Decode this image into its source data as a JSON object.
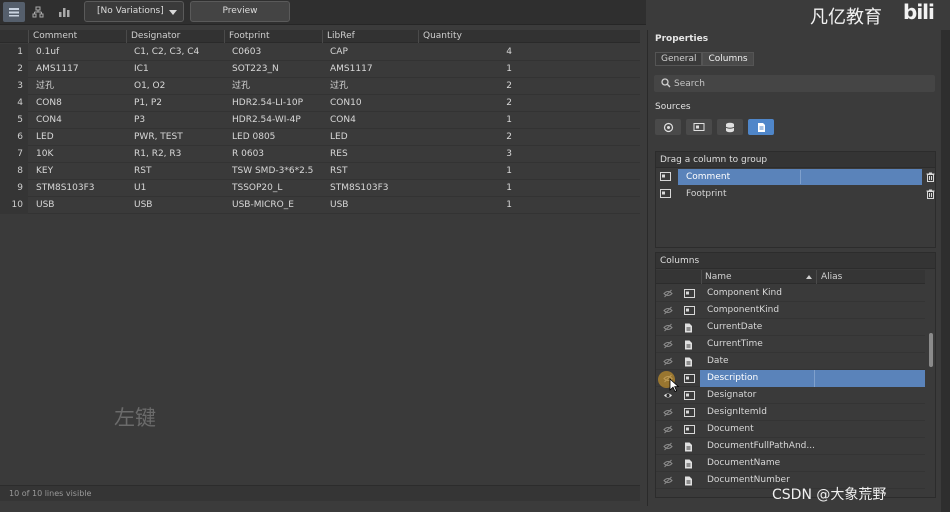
{
  "toolbar": {
    "variations": "[No Variations]",
    "preview": "Preview"
  },
  "grid": {
    "headers": [
      "Comment",
      "Designator",
      "Footprint",
      "LibRef",
      "Quantity"
    ],
    "rows": [
      {
        "n": "1",
        "comment": "0.1uf",
        "designator": "C1, C2, C3, C4",
        "footprint": "C0603",
        "libref": "CAP",
        "quantity": "4"
      },
      {
        "n": "2",
        "comment": "AMS1117",
        "designator": "IC1",
        "footprint": "SOT223_N",
        "libref": "AMS1117",
        "quantity": "1"
      },
      {
        "n": "3",
        "comment": "过孔",
        "designator": "O1, O2",
        "footprint": "过孔",
        "libref": "过孔",
        "quantity": "2"
      },
      {
        "n": "4",
        "comment": "CON8",
        "designator": "P1, P2",
        "footprint": "HDR2.54-LI-10P",
        "libref": "CON10",
        "quantity": "2"
      },
      {
        "n": "5",
        "comment": "CON4",
        "designator": "P3",
        "footprint": "HDR2.54-WI-4P",
        "libref": "CON4",
        "quantity": "1"
      },
      {
        "n": "6",
        "comment": "LED",
        "designator": "PWR, TEST",
        "footprint": "LED 0805",
        "libref": "LED",
        "quantity": "2"
      },
      {
        "n": "7",
        "comment": "10K",
        "designator": "R1, R2, R3",
        "footprint": "R 0603",
        "libref": "RES",
        "quantity": "3"
      },
      {
        "n": "8",
        "comment": "KEY",
        "designator": "RST",
        "footprint": "TSW SMD-3*6*2.5",
        "libref": "RST",
        "quantity": "1"
      },
      {
        "n": "9",
        "comment": "STM8S103F3",
        "designator": "U1",
        "footprint": "TSSOP20_L",
        "libref": "STM8S103F3",
        "quantity": "1"
      },
      {
        "n": "10",
        "comment": "USB",
        "designator": "USB",
        "footprint": "USB-MICRO_E",
        "libref": "USB",
        "quantity": "1"
      }
    ],
    "status": "10 of 10 lines visible"
  },
  "overlay": {
    "left_key_caption": "左键",
    "brand_text": "凡亿教育",
    "brand_logo": "bili",
    "csdn_watermark": "CSDN @大象荒野"
  },
  "panel": {
    "title": "Properties",
    "tabs": [
      "General",
      "Columns"
    ],
    "selected_tab": "Columns",
    "search_placeholder": "Search",
    "sources_label": "Sources",
    "sources_icons": [
      "component-source-icon",
      "board-source-icon",
      "database-source-icon",
      "document-source-icon"
    ],
    "group_header": "Drag a column to group",
    "group_items": [
      {
        "label": "Comment",
        "selected": true
      },
      {
        "label": "Footprint",
        "selected": false
      }
    ],
    "columns_header": "Columns",
    "col_name_header": "Name",
    "col_alias_header": "Alias",
    "columns": [
      {
        "name": "Component Kind",
        "type": "param",
        "visible": false
      },
      {
        "name": "ComponentKind",
        "type": "param",
        "visible": false
      },
      {
        "name": "CurrentDate",
        "type": "doc",
        "visible": false
      },
      {
        "name": "CurrentTime",
        "type": "doc",
        "visible": false
      },
      {
        "name": "Date",
        "type": "doc",
        "visible": false
      },
      {
        "name": "Description",
        "type": "param",
        "visible": false,
        "selected": true
      },
      {
        "name": "Designator",
        "type": "param",
        "visible": true
      },
      {
        "name": "DesignItemId",
        "type": "param",
        "visible": false
      },
      {
        "name": "Document",
        "type": "param",
        "visible": false
      },
      {
        "name": "DocumentFullPathAnd...",
        "type": "doc",
        "visible": false
      },
      {
        "name": "DocumentName",
        "type": "doc",
        "visible": false
      },
      {
        "name": "DocumentNumber",
        "type": "doc",
        "visible": false
      }
    ]
  },
  "colors": {
    "background": "#3b3b3b",
    "selection": "#5a83ba",
    "source_active": "#4f86c9"
  }
}
